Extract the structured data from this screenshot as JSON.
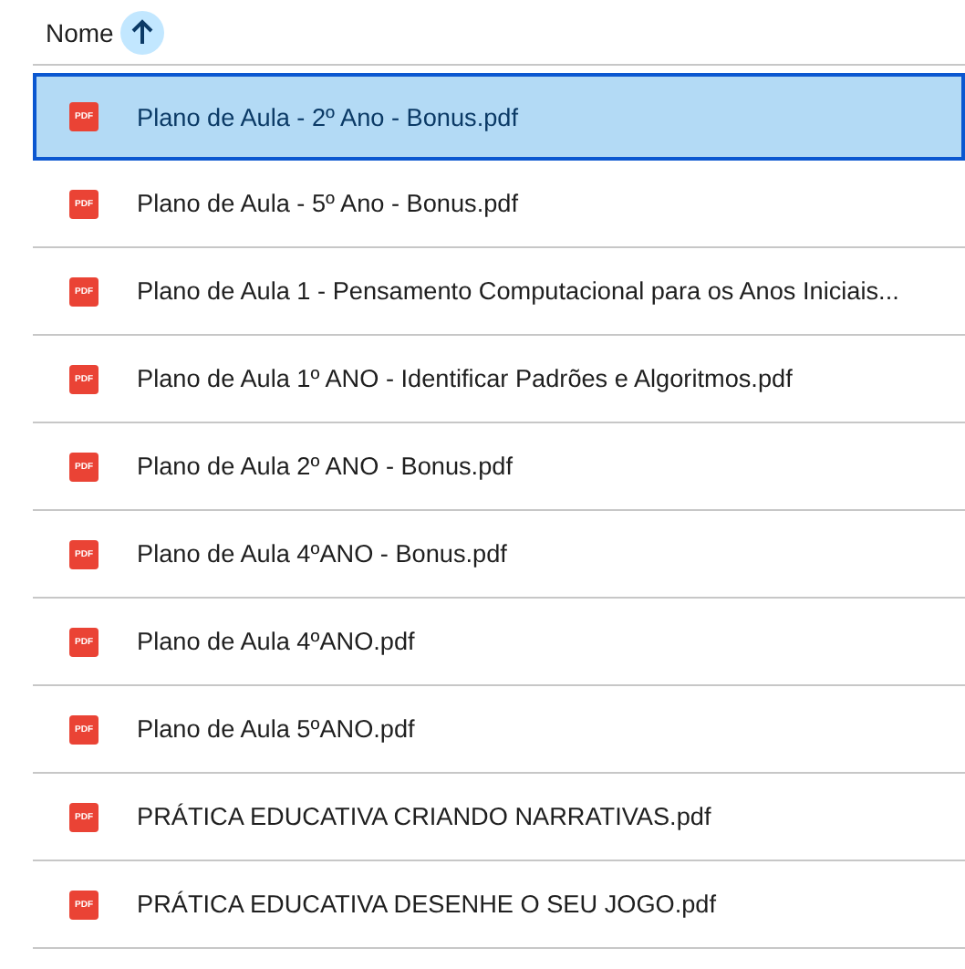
{
  "header": {
    "label": "Nome",
    "sort_ascending": true
  },
  "files": [
    {
      "name": "Plano de Aula - 2º Ano - Bonus.pdf",
      "badge": "PDF",
      "selected": true
    },
    {
      "name": "Plano de Aula - 5º Ano - Bonus.pdf",
      "badge": "PDF",
      "selected": false
    },
    {
      "name": "Plano de Aula 1 - Pensamento Computacional para os Anos Iniciais...",
      "badge": "PDF",
      "selected": false
    },
    {
      "name": "Plano de Aula 1º ANO - Identificar Padrões e Algoritmos.pdf",
      "badge": "PDF",
      "selected": false
    },
    {
      "name": "Plano de Aula 2º ANO - Bonus.pdf",
      "badge": "PDF",
      "selected": false
    },
    {
      "name": "Plano de Aula 4ºANO - Bonus.pdf",
      "badge": "PDF",
      "selected": false
    },
    {
      "name": "Plano de Aula 4ºANO.pdf",
      "badge": "PDF",
      "selected": false
    },
    {
      "name": "Plano de Aula 5ºANO.pdf",
      "badge": "PDF",
      "selected": false
    },
    {
      "name": "PRÁTICA EDUCATIVA CRIANDO NARRATIVAS.pdf",
      "badge": "PDF",
      "selected": false
    },
    {
      "name": "PRÁTICA EDUCATIVA DESENHE O SEU JOGO.pdf",
      "badge": "PDF",
      "selected": false
    }
  ]
}
